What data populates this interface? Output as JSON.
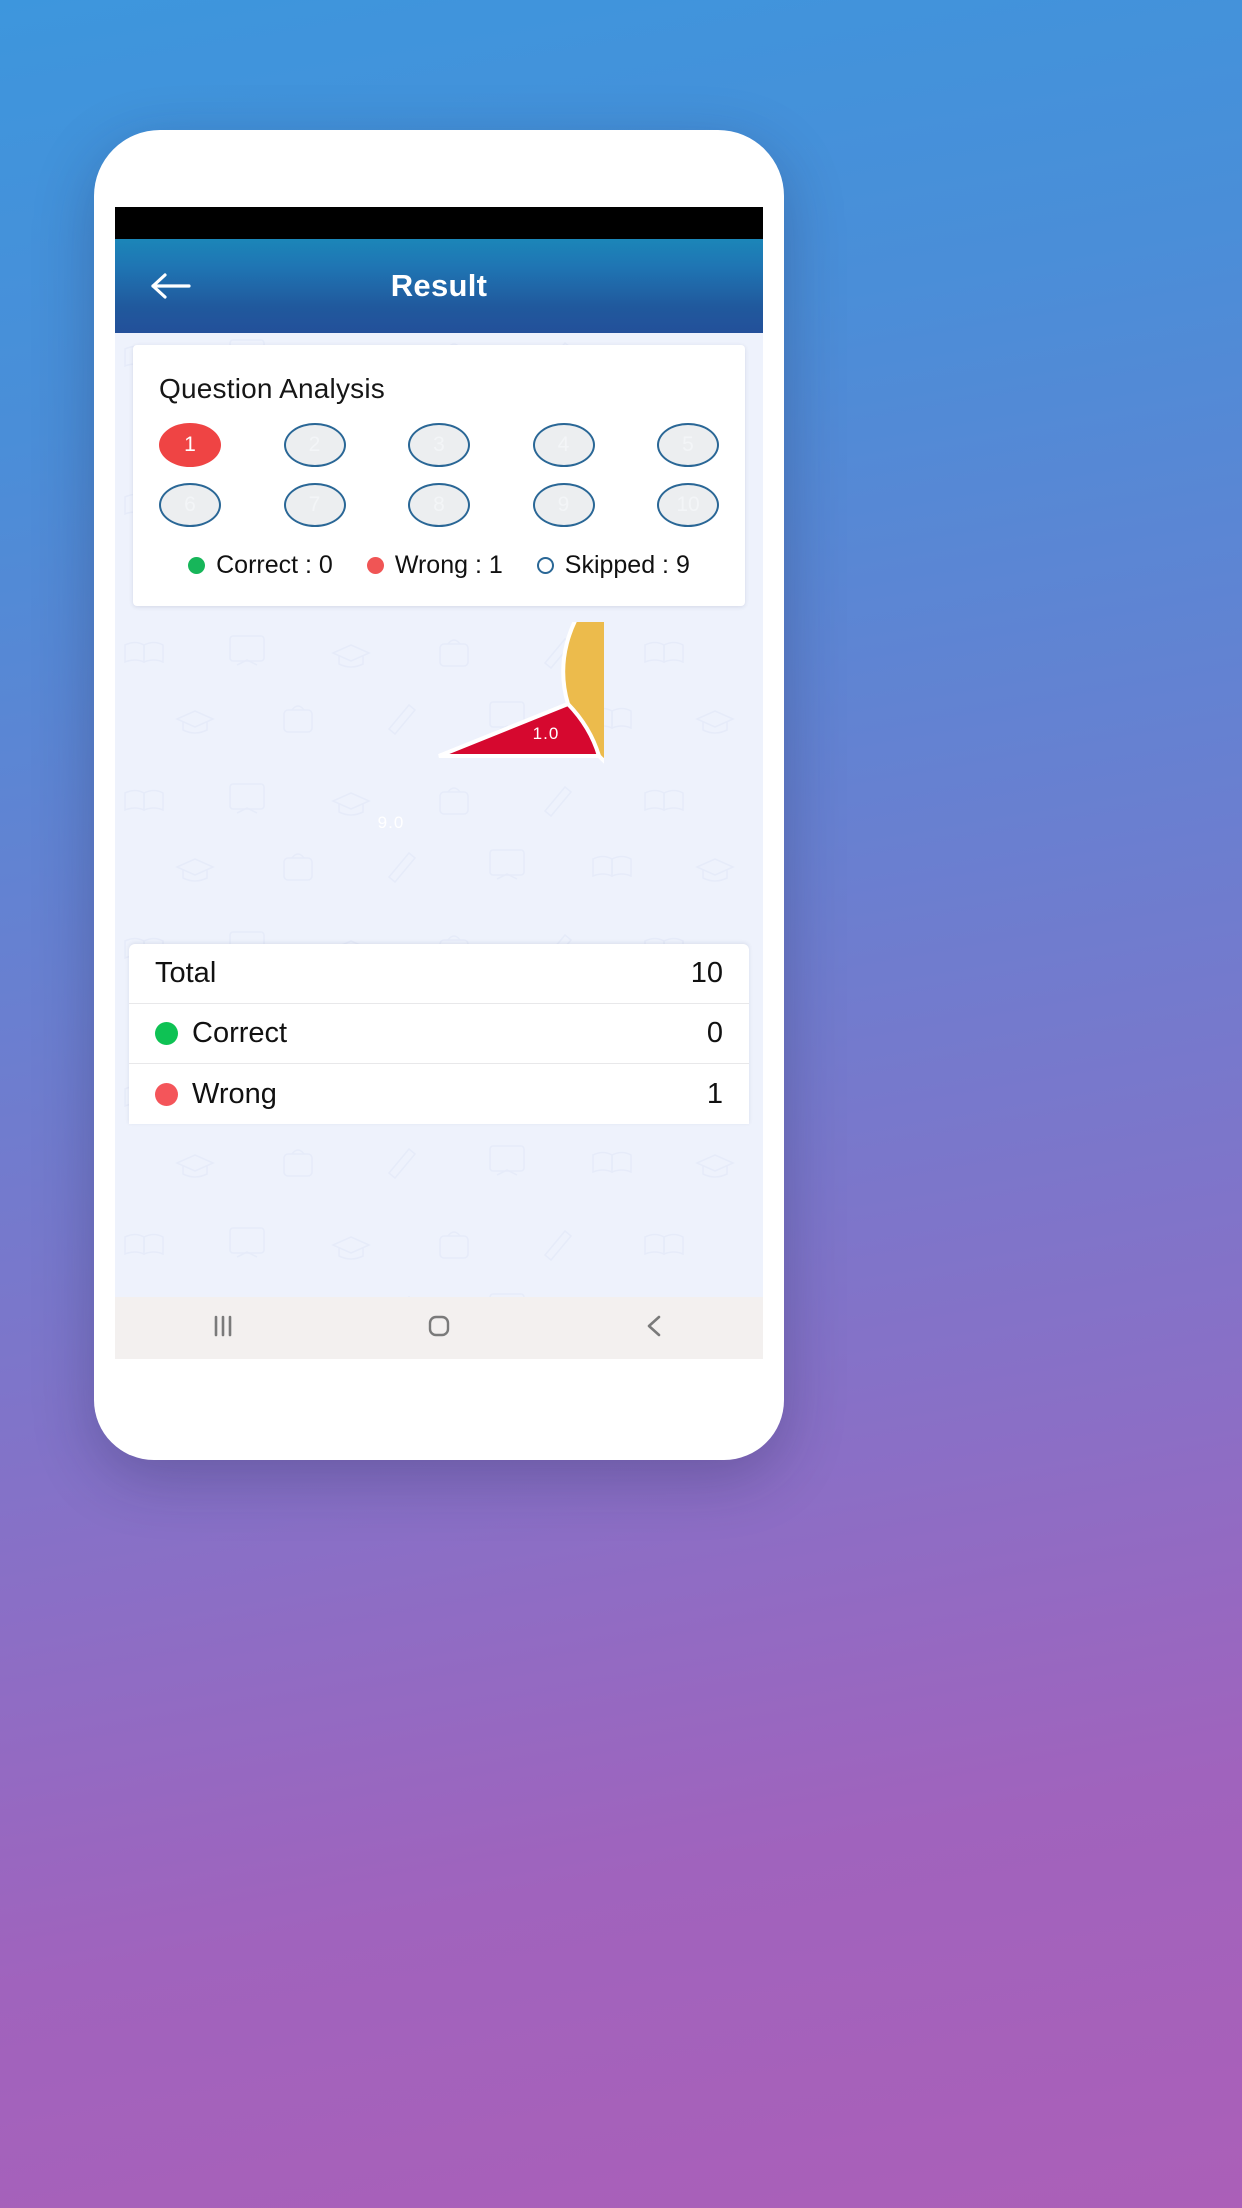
{
  "app_bar": {
    "title": "Result",
    "back_icon": "arrow-left-icon"
  },
  "question_analysis": {
    "heading": "Question Analysis",
    "bubbles": [
      {
        "number": "1",
        "state": "wrong"
      },
      {
        "number": "2",
        "state": "skipped"
      },
      {
        "number": "3",
        "state": "skipped"
      },
      {
        "number": "4",
        "state": "skipped"
      },
      {
        "number": "5",
        "state": "skipped"
      },
      {
        "number": "6",
        "state": "skipped"
      },
      {
        "number": "7",
        "state": "skipped"
      },
      {
        "number": "8",
        "state": "skipped"
      },
      {
        "number": "9",
        "state": "skipped"
      },
      {
        "number": "10",
        "state": "skipped"
      }
    ],
    "legend": [
      {
        "label": "Correct : 0",
        "dot": "green",
        "icon": "green-dot-icon"
      },
      {
        "label": "Wrong : 1",
        "dot": "red",
        "icon": "red-dot-icon"
      },
      {
        "label": "Skipped : 9",
        "dot": "hollow",
        "icon": "hollow-dot-icon"
      }
    ]
  },
  "chart_data": {
    "type": "pie",
    "title": "",
    "categories": [
      "Skipped",
      "Wrong"
    ],
    "values": [
      9.0,
      1.0
    ],
    "labels": [
      "9.0",
      "1.0"
    ],
    "colors": [
      "#ecbb4c",
      "#d6082f"
    ],
    "legend_position": "none",
    "slice_gap_color": "#ffffff",
    "total": 10.0
  },
  "summary": {
    "rows": [
      {
        "label": "Total",
        "value": "10",
        "dot": "none"
      },
      {
        "label": "Correct",
        "value": "0",
        "dot": "green"
      },
      {
        "label": "Wrong",
        "value": "1",
        "dot": "red"
      }
    ]
  },
  "nav_bar": {
    "recents_icon": "recents-icon",
    "home_icon": "home-icon",
    "back_icon": "back-chevron-icon"
  },
  "colors": {
    "app_bar_top": "#1b86b8",
    "app_bar_bottom": "#23509a",
    "wrong": "#ef4444",
    "correct": "#0bb84f",
    "skipped_border": "#2a6796",
    "pie_yellow": "#ecbb4c",
    "pie_red": "#d6082f",
    "page_bg": "#eef2fc"
  }
}
